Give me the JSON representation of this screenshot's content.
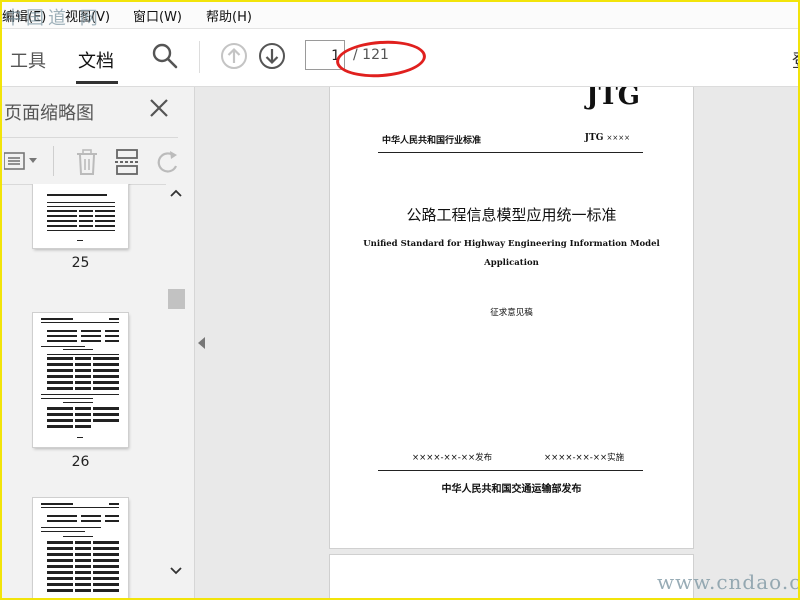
{
  "watermark_top": "中国道 网",
  "menu": {
    "edit": "编辑(E)",
    "view": "视图(V)",
    "window": "窗口(W)",
    "help": "帮助(H)"
  },
  "toolbar": {
    "tab_tools": "工具",
    "tab_document": "文档",
    "current_page": "1",
    "total_pages": "/ 121",
    "edge_text": "登"
  },
  "side_panel": {
    "title": "页面缩略图",
    "thumbnails": [
      {
        "page": "25"
      },
      {
        "page": "26"
      }
    ]
  },
  "document": {
    "logo": "JTG",
    "header_left": "中华人民共和国行业标准",
    "header_right": "JTG",
    "header_right_suffix": "××××",
    "title_cn": "公路工程信息模型应用统一标准",
    "title_en": "Unified Standard for Highway Engineering Information Model Application",
    "draft_label": "征求意见稿",
    "issue_date": "××××-××-××发布",
    "impl_date": "××××-××-××实施",
    "publisher": "中华人民共和国交通运输部发布"
  },
  "site_watermark": "www.cndao.com",
  "colors": {
    "highlight_ellipse": "#e0201e",
    "frame_border": "#f2e40a",
    "doc_background": "#e9e9e9"
  }
}
